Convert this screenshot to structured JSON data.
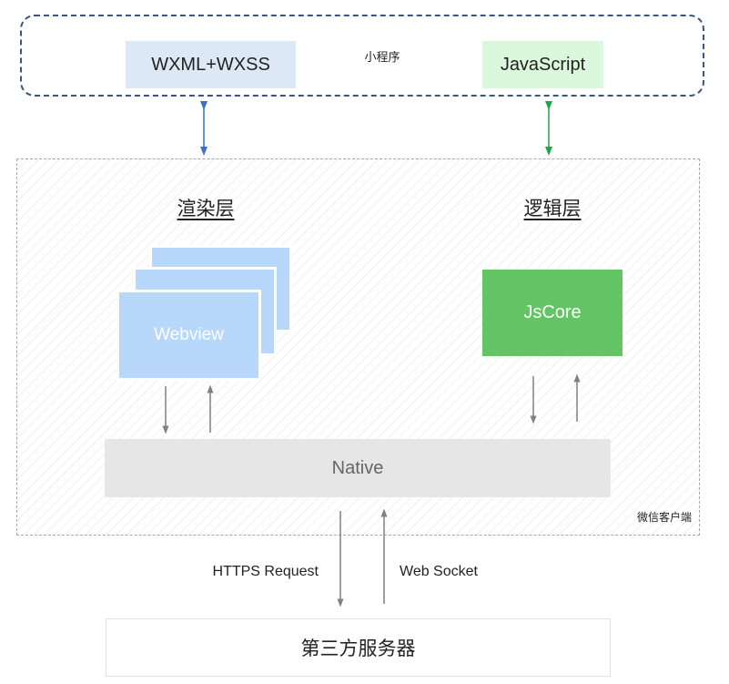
{
  "mini_program": {
    "title": "小程序",
    "wxml": "WXML+WXSS",
    "javascript": "JavaScript"
  },
  "client": {
    "label": "微信客户端",
    "render_layer": "渲染层",
    "logic_layer": "逻辑层",
    "webview": "Webview",
    "jscore": "JsCore",
    "native": "Native"
  },
  "network": {
    "https_request": "HTTPS Request",
    "web_socket": "Web Socket"
  },
  "server": {
    "label": "第三方服务器"
  },
  "colors": {
    "mini_border": "#3a5583",
    "wxml_bg": "#dde8f6",
    "js_bg": "#dcf8dc",
    "webview_bg": "#b7d7fb",
    "jscore_bg": "#62c462",
    "native_bg": "#e6e6e6",
    "blue_arrow": "#3f6fc6",
    "green_arrow": "#1aa64a",
    "gray_arrow": "#808080"
  }
}
